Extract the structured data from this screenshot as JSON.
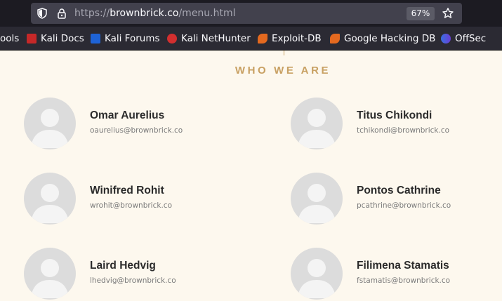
{
  "browser": {
    "url": {
      "scheme": "https://",
      "host": "brownbrick.co",
      "path": "/menu.html"
    },
    "zoom": "67%",
    "icons": {
      "shield": "tracking-protection-shield-icon",
      "lock": "lock-icon",
      "star": "bookmark-star-icon"
    },
    "bookmarks": [
      {
        "label": "ools",
        "icon": "none"
      },
      {
        "label": "Kali Docs",
        "icon": "kali-docs-icon"
      },
      {
        "label": "Kali Forums",
        "icon": "kali-forums-icon"
      },
      {
        "label": "Kali NetHunter",
        "icon": "kali-nethunter-icon"
      },
      {
        "label": "Exploit-DB",
        "icon": "exploit-db-icon"
      },
      {
        "label": "Google Hacking DB",
        "icon": "google-hacking-db-icon"
      },
      {
        "label": "OffSec",
        "icon": "offsec-icon"
      }
    ],
    "colors": {
      "toolbar": "#1c1b22",
      "urlbar": "#42414d",
      "bookmarks_bar": "#2b2a33"
    }
  },
  "page": {
    "section_title": "WHO WE ARE",
    "accent_color": "#c8a062",
    "background": "#fdf8ee",
    "members": [
      {
        "name": "Omar Aurelius",
        "email": "oaurelius@brownbrick.co"
      },
      {
        "name": "Titus Chikondi",
        "email": "tchikondi@brownbrick.co"
      },
      {
        "name": "Winifred Rohit",
        "email": "wrohit@brownbrick.co"
      },
      {
        "name": "Pontos Cathrine",
        "email": "pcathrine@brownbrick.co"
      },
      {
        "name": "Laird Hedvig",
        "email": "lhedvig@brownbrick.co"
      },
      {
        "name": "Filimena Stamatis",
        "email": "fstamatis@brownbrick.co"
      }
    ]
  }
}
